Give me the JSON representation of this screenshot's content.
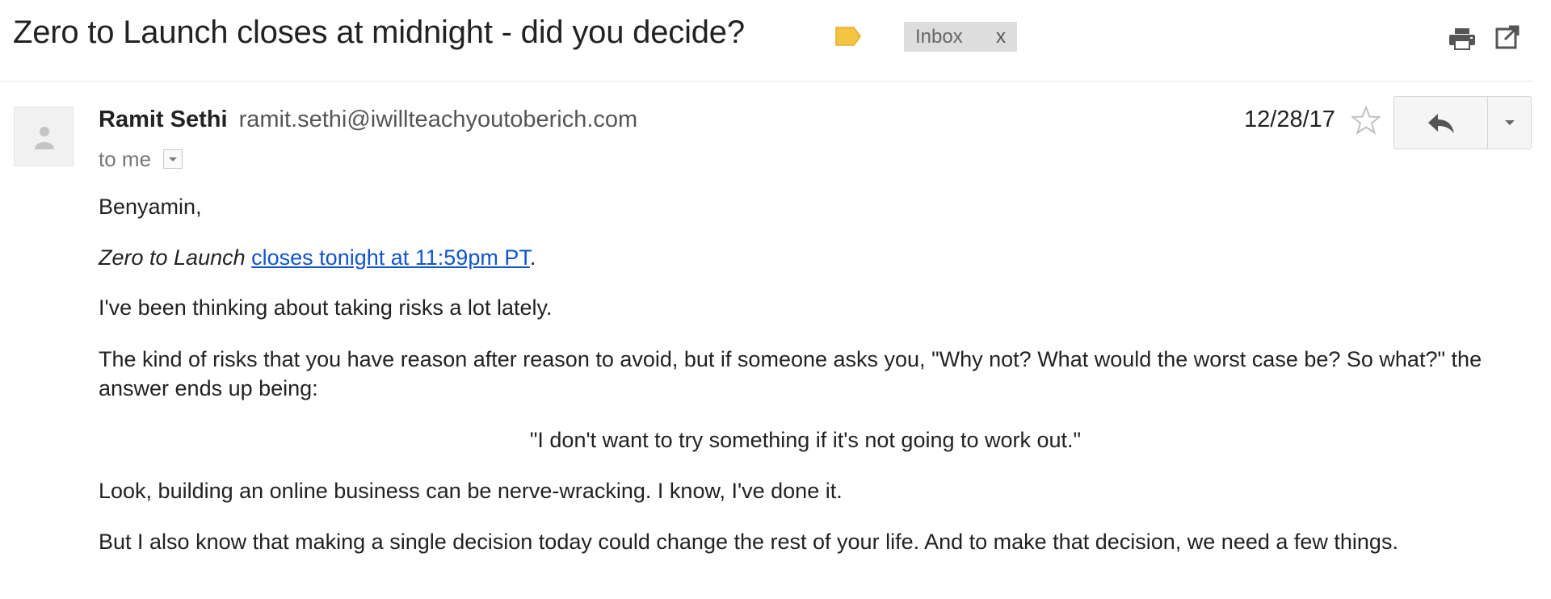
{
  "thread": {
    "subject": "Zero to Launch closes at midnight - did you decide?",
    "label_chip": "Inbox",
    "label_chip_remove": "x",
    "label_tag_color": "#f4c542"
  },
  "icons": {
    "label": "label-tag-icon",
    "print": "print-icon",
    "popout": "new-window-icon",
    "avatar": "person-icon",
    "star": "star-icon",
    "reply": "reply-icon",
    "more": "chevron-down-icon"
  },
  "message": {
    "sender_name": "Ramit Sethi",
    "sender_email": "ramit.sethi@iwillteachyoutoberich.com",
    "recipient": "to me",
    "date": "12/28/17"
  },
  "body": {
    "greeting": "Benyamin,",
    "launch_italic": "Zero to Launch",
    "launch_link": "closes tonight at 11:59pm PT",
    "launch_end": ".",
    "risks": "I've been thinking about taking risks a lot lately.",
    "kind": "The kind of risks that you have reason after reason to avoid, but if someone asks you, \"Why not? What would the worst case be? So what?\" the answer ends up being:",
    "quote": "\"I don't want to try something if it's not going to work out.\"",
    "look": "Look, building an online business can be nerve-wracking. I know, I've done it.",
    "but": "But I also know that making a single decision today could change the rest of your life. And to make that decision, we need a few things."
  },
  "colors": {
    "link": "#1155cc",
    "chip_bg": "#dddddd",
    "button_bg": "#f5f5f5"
  }
}
